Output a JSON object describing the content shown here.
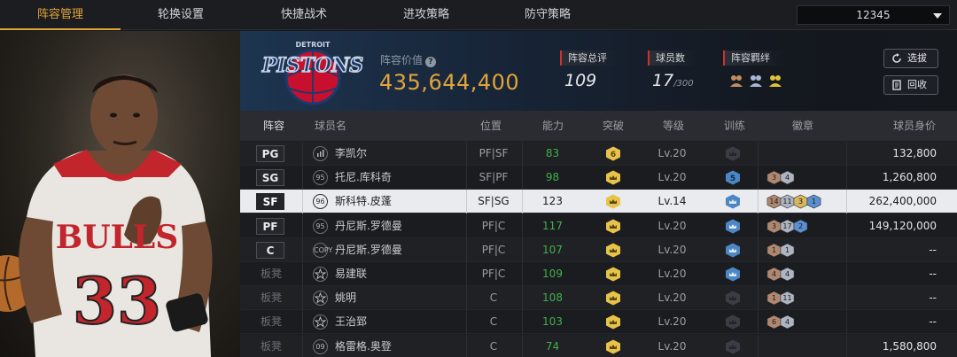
{
  "nav": {
    "tabs": [
      "阵容管理",
      "轮换设置",
      "快捷战术",
      "进攻策略",
      "防守策略"
    ],
    "active_tab": 0,
    "team_selector": "12345"
  },
  "header": {
    "team_logo_text": "PISTONS",
    "team_logo_city": "DETROIT",
    "value_label": "阵容价值",
    "value": "435,644,400",
    "rating_label": "阵容总评",
    "rating": "109",
    "players_label": "球员数",
    "players": "17",
    "players_max": "/300",
    "bond_label": "阵容羁绊",
    "btn_select": "选拔",
    "btn_recycle": "回收",
    "accent": "#e2a43a",
    "red": "#d0312d"
  },
  "table": {
    "headers": [
      "阵容",
      "球员名",
      "位置",
      "能力",
      "突破",
      "等级",
      "训练",
      "徽章",
      "球员身价"
    ],
    "rows": [
      {
        "slot": "PG",
        "bench": false,
        "icon": "bars",
        "name": "李凯尔",
        "position": "PF|SF",
        "ability": "83",
        "breakthrough": "6",
        "level": "Lv.20",
        "training": "",
        "badges": [],
        "price": "132,800",
        "selected": false
      },
      {
        "slot": "SG",
        "bench": false,
        "icon": "95",
        "name": "托尼.库科奇",
        "position": "SF|PF",
        "ability": "98",
        "breakthrough": "crown",
        "level": "Lv.20",
        "training": "5",
        "badges": [
          {
            "v": "3",
            "c": "bronze"
          },
          {
            "v": "4",
            "c": "silver"
          }
        ],
        "price": "1,260,800",
        "selected": false
      },
      {
        "slot": "SF",
        "bench": false,
        "icon": "96",
        "name": "斯科特.皮蓬",
        "position": "SF|SG",
        "ability": "123",
        "breakthrough": "crown",
        "level": "Lv.14",
        "training": "crown",
        "badges": [
          {
            "v": "14",
            "c": "bronze"
          },
          {
            "v": "11",
            "c": "silver"
          },
          {
            "v": "3",
            "c": "gold"
          },
          {
            "v": "1",
            "c": "blue"
          }
        ],
        "price": "262,400,000",
        "selected": true
      },
      {
        "slot": "PF",
        "bench": false,
        "icon": "95",
        "name": "丹尼斯.罗德曼",
        "position": "PF|C",
        "ability": "117",
        "breakthrough": "crown",
        "level": "Lv.20",
        "training": "crown",
        "badges": [
          {
            "v": "3",
            "c": "bronze"
          },
          {
            "v": "17",
            "c": "silver"
          },
          {
            "v": "2",
            "c": "blue"
          }
        ],
        "price": "149,120,000",
        "selected": false
      },
      {
        "slot": "C",
        "bench": false,
        "icon": "COPY",
        "name": "丹尼斯.罗德曼",
        "position": "PF|C",
        "ability": "107",
        "breakthrough": "crown",
        "level": "Lv.20",
        "training": "crown",
        "badges": [
          {
            "v": "1",
            "c": "bronze"
          },
          {
            "v": "1",
            "c": "silver"
          }
        ],
        "price": "--",
        "selected": false
      },
      {
        "slot": "板凳",
        "bench": true,
        "icon": "star",
        "name": "易建联",
        "position": "PF|C",
        "ability": "109",
        "breakthrough": "crown",
        "level": "Lv.20",
        "training": "crown",
        "badges": [
          {
            "v": "4",
            "c": "bronze"
          },
          {
            "v": "4",
            "c": "silver"
          }
        ],
        "price": "--",
        "selected": false
      },
      {
        "slot": "板凳",
        "bench": true,
        "icon": "star",
        "name": "姚明",
        "position": "C",
        "ability": "108",
        "breakthrough": "crown",
        "level": "Lv.20",
        "training": "",
        "badges": [
          {
            "v": "1",
            "c": "bronze"
          },
          {
            "v": "11",
            "c": "silver"
          }
        ],
        "price": "--",
        "selected": false
      },
      {
        "slot": "板凳",
        "bench": true,
        "icon": "star",
        "name": "王治郅",
        "position": "C",
        "ability": "103",
        "breakthrough": "crown",
        "level": "Lv.20",
        "training": "",
        "badges": [
          {
            "v": "6",
            "c": "bronze"
          },
          {
            "v": "4",
            "c": "silver"
          }
        ],
        "price": "--",
        "selected": false
      },
      {
        "slot": "板凳",
        "bench": true,
        "icon": "09",
        "name": "格雷格.奥登",
        "position": "C",
        "ability": "74",
        "breakthrough": "crown",
        "level": "Lv.20",
        "training": "",
        "badges": [],
        "price": "1,580,800",
        "selected": false
      }
    ]
  }
}
